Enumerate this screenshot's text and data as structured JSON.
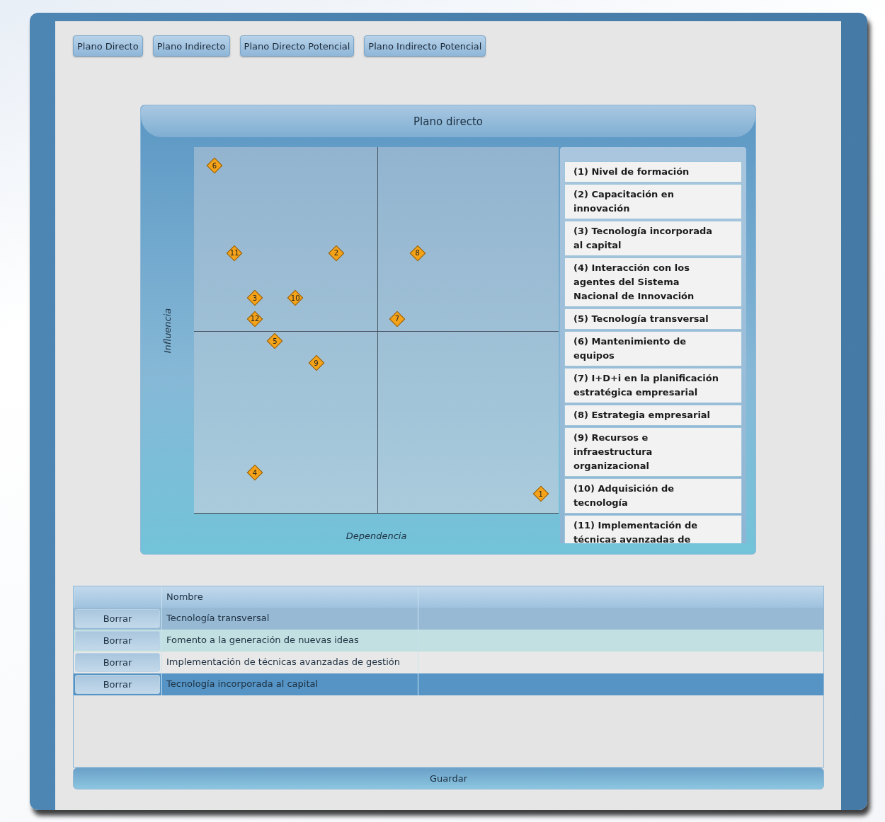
{
  "view_buttons": [
    {
      "label": "Plano Directo"
    },
    {
      "label": "Plano Indirecto"
    },
    {
      "label": "Plano Directo Potencial"
    },
    {
      "label": "Plano Indirecto Potencial"
    }
  ],
  "plot": {
    "title": "Plano directo",
    "ylabel": "Influencia",
    "xlabel": "Dependencia",
    "points": [
      {
        "label": "1"
      },
      {
        "label": "2"
      },
      {
        "label": "3"
      },
      {
        "label": "4"
      },
      {
        "label": "5"
      },
      {
        "label": "6"
      },
      {
        "label": "7"
      },
      {
        "label": "8"
      },
      {
        "label": "9"
      },
      {
        "label": "10"
      },
      {
        "label": "11"
      },
      {
        "label": "12"
      }
    ],
    "legend": [
      "(1) Nivel de formación",
      "(2) Capacitación en innovación",
      "(3) Tecnología incorporada al capital",
      "(4) Interacción con los agentes del Sistema Nacional de Innovación",
      "(5) Tecnología transversal",
      "(6) Mantenimiento de equipos",
      "(7) I+D+i en la planificación estratégica empresarial",
      "(8) Estrategia empresarial",
      "(9) Recursos e infraestructura organizacional",
      "(10) Adquisición de tecnología",
      "(11) Implementación de técnicas avanzadas de"
    ]
  },
  "table": {
    "columns": [
      "Nombre"
    ],
    "rows": [
      {
        "action": "Borrar",
        "name": "Tecnología transversal",
        "selected": false,
        "hovered": true
      },
      {
        "action": "Borrar",
        "name": "Fomento a la generación de nuevas ideas",
        "selected": false,
        "hovered": false
      },
      {
        "action": "Borrar",
        "name": "Implementación de técnicas avanzadas de gestión",
        "selected": false,
        "hovered": false
      },
      {
        "action": "Borrar",
        "name": "Tecnología incorporada al capital",
        "selected": true,
        "hovered": false
      }
    ]
  },
  "save_button": {
    "label": "Guardar"
  }
}
